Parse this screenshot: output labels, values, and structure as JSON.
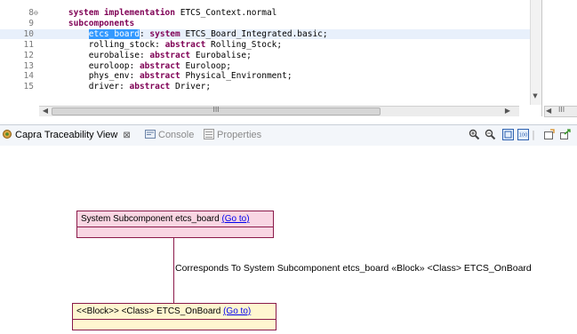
{
  "editor": {
    "lines": [
      {
        "num": "8",
        "fold": "⊖",
        "segments": [
          {
            "t": "    "
          },
          {
            "t": "system implementation",
            "k": true
          },
          {
            "t": " ETCS_Context.normal"
          }
        ]
      },
      {
        "num": "9",
        "fold": "",
        "segments": [
          {
            "t": "    "
          },
          {
            "t": "subcomponents",
            "k": true
          }
        ]
      },
      {
        "num": "10",
        "fold": "",
        "current": true,
        "segments": [
          {
            "t": "        "
          },
          {
            "t": "etcs_board",
            "sel": true
          },
          {
            "t": ": "
          },
          {
            "t": "system",
            "k": true
          },
          {
            "t": " ETCS_Board_Integrated.basic;"
          }
        ]
      },
      {
        "num": "11",
        "fold": "",
        "segments": [
          {
            "t": "        rolling_stock: "
          },
          {
            "t": "abstract",
            "k": true
          },
          {
            "t": " Rolling_Stock;"
          }
        ]
      },
      {
        "num": "12",
        "fold": "",
        "segments": [
          {
            "t": "        eurobalise: "
          },
          {
            "t": "abstract",
            "k": true
          },
          {
            "t": " Eurobalise;"
          }
        ]
      },
      {
        "num": "13",
        "fold": "",
        "segments": [
          {
            "t": "        euroloop: "
          },
          {
            "t": "abstract",
            "k": true
          },
          {
            "t": " Euroloop;"
          }
        ]
      },
      {
        "num": "14",
        "fold": "",
        "segments": [
          {
            "t": "        phys_env: "
          },
          {
            "t": "abstract",
            "k": true
          },
          {
            "t": " Physical_Environment;"
          }
        ]
      },
      {
        "num": "15",
        "fold": "",
        "segments": [
          {
            "t": "        driver: "
          },
          {
            "t": "abstract",
            "k": true
          },
          {
            "t": " Driver;"
          }
        ]
      }
    ],
    "scroll_grip": "III"
  },
  "right_pane": {
    "scroll_grip": "III"
  },
  "tabs": {
    "capra": "Capra Traceability View",
    "console": "Console",
    "properties": "Properties"
  },
  "diagram": {
    "node_a": {
      "label": "System Subcomponent etcs_board",
      "link": "(Go to)"
    },
    "node_b": {
      "label": "<<Block>> <Class> ETCS_OnBoard",
      "link": "(Go to)"
    },
    "edge_label": "Corresponds To  System Subcomponent etcs_board «Block» <Class> ETCS_OnBoard"
  },
  "colors": {
    "keyword": "#7f0055",
    "selection": "#3399ff",
    "node_a_fill": "#f9d6e3",
    "node_b_fill": "#fff6d0",
    "node_border": "#8b1a4a",
    "link": "#0000ee"
  },
  "icons": [
    "fold-collapse-icon",
    "capra-view-icon",
    "close-icon",
    "console-icon",
    "properties-icon",
    "zoom-in-icon",
    "zoom-out-icon",
    "zoom-fit-icon",
    "zoom-100-icon",
    "new-view-icon",
    "export-icon"
  ]
}
